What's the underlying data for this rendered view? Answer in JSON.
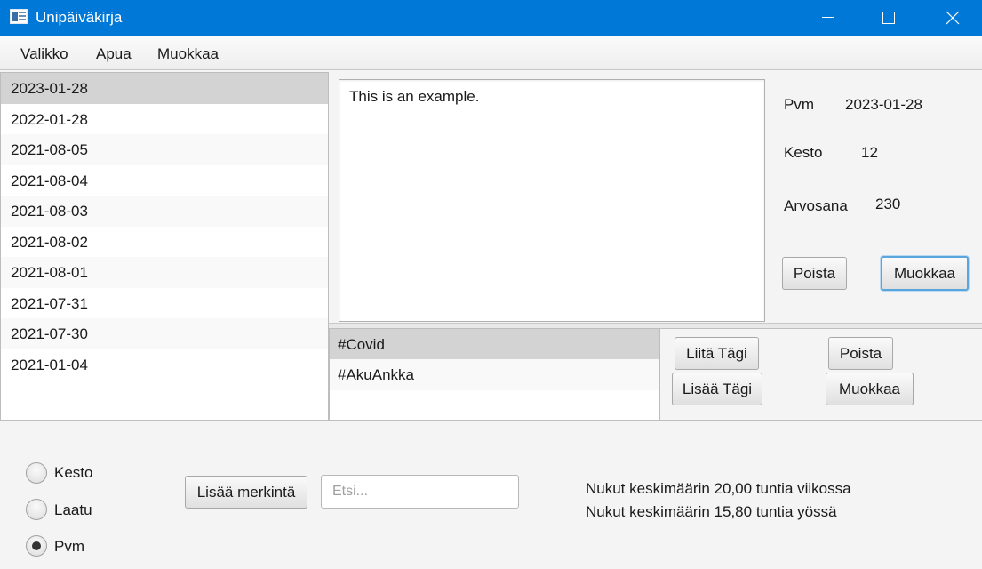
{
  "window": {
    "title": "Unipäiväkirja",
    "minimize_icon": "minimize-icon",
    "maximize_icon": "maximize-icon",
    "close_icon": "close-icon"
  },
  "menu": [
    "Valikko",
    "Apua",
    "Muokkaa"
  ],
  "dates": [
    "2023-01-28",
    "2022-01-28",
    "2021-08-05",
    "2021-08-04",
    "2021-08-03",
    "2021-08-02",
    "2021-08-01",
    "2021-07-31",
    "2021-07-30",
    "2021-01-04"
  ],
  "selected_date_index": 0,
  "entry_text": "This is an example.",
  "details": {
    "pvm_label": "Pvm",
    "pvm_value": "2023-01-28",
    "kesto_label": "Kesto",
    "kesto_value": "12",
    "arvosana_label": "Arvosana",
    "arvosana_value": "230",
    "delete_label": "Poista",
    "edit_label": "Muokkaa"
  },
  "tags": [
    "#Covid",
    "#AkuAnkka"
  ],
  "selected_tag_index": 0,
  "tag_actions": {
    "attach_label": "Liitä Tägi",
    "add_label": "Lisää Tägi",
    "delete_label": "Poista",
    "edit_label": "Muokkaa"
  },
  "sort_options": [
    "Kesto",
    "Laatu",
    "Pvm"
  ],
  "selected_sort": "Pvm",
  "add_entry_label": "Lisää merkintä",
  "search": {
    "placeholder": "Etsi...",
    "value": ""
  },
  "stats": {
    "weekly": "Nukut keskimäärin 20,00 tuntia viikossa",
    "nightly": "Nukut keskimäärin 15,80 tuntia yössä"
  },
  "colors": {
    "titlebar": "#0078d7",
    "selection": "#d3d3d3",
    "focus": "#5ba5dd"
  }
}
